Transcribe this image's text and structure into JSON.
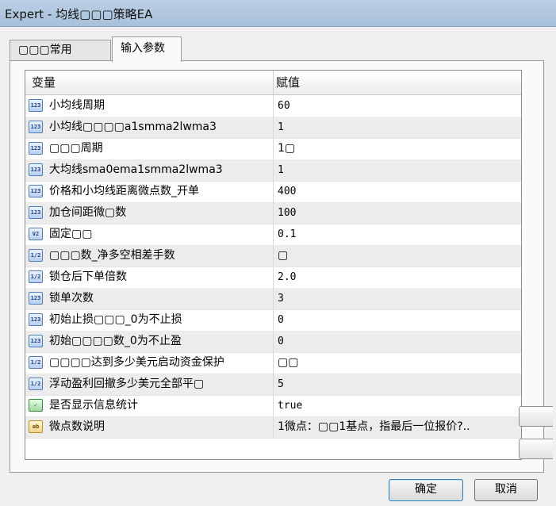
{
  "window": {
    "title": "Expert - 均线▢▢▢策略EA"
  },
  "tabs": [
    {
      "label": "▢▢▢常用"
    },
    {
      "label": "输入参数"
    }
  ],
  "grid": {
    "header": {
      "name": "变量",
      "value": "赋值"
    },
    "rows": [
      {
        "icon": "int-icon",
        "icon_text": "123",
        "name": "小均线周期",
        "value": "60"
      },
      {
        "icon": "int-icon",
        "icon_text": "123",
        "name": "小均线▢▢▢▢a1smma2lwma3",
        "value": "1"
      },
      {
        "icon": "int-icon",
        "icon_text": "123",
        "name": "▢▢▢周期",
        "value": "1▢"
      },
      {
        "icon": "int-icon",
        "icon_text": "123",
        "name": "大均线sma0ema1smma2lwma3",
        "value": "1"
      },
      {
        "icon": "int-icon",
        "icon_text": "123",
        "name": "价格和小均线距离微点数_开单",
        "value": "400"
      },
      {
        "icon": "int-icon",
        "icon_text": "123",
        "name": "加仓间距微▢数",
        "value": "100"
      },
      {
        "icon": "double-icon",
        "icon_text": "V2",
        "name": "固定▢▢",
        "value": "0.1"
      },
      {
        "icon": "double-icon",
        "icon_text": "1/2",
        "name": "▢▢▢数_净多空相差手数",
        "value": "▢"
      },
      {
        "icon": "double-icon",
        "icon_text": "1/2",
        "name": "锁仓后下单倍数",
        "value": "2.0"
      },
      {
        "icon": "int-icon",
        "icon_text": "123",
        "name": "锁单次数",
        "value": "3"
      },
      {
        "icon": "int-icon",
        "icon_text": "123",
        "name": "初始止损▢▢▢_0为不止损",
        "value": "0"
      },
      {
        "icon": "int-icon",
        "icon_text": "123",
        "name": "初始▢▢▢▢数_0为不止盈",
        "value": "0"
      },
      {
        "icon": "double-icon",
        "icon_text": "1/2",
        "name": "▢▢▢▢达到多少美元启动资金保护",
        "value": "▢▢"
      },
      {
        "icon": "double-icon",
        "icon_text": "1/2",
        "name": "浮动盈利回撤多少美元全部平▢",
        "value": "5"
      },
      {
        "icon": "bool-icon",
        "icon_text": "✓",
        "name": "是否显示信息统计",
        "value": "true"
      },
      {
        "icon": "text-icon",
        "icon_text": "ab",
        "name": "微点数说明",
        "value": "1微点：▢▢1基点，指最后一位报价?.."
      }
    ]
  },
  "buttons": {
    "ok": "确定",
    "cancel": "取消"
  }
}
